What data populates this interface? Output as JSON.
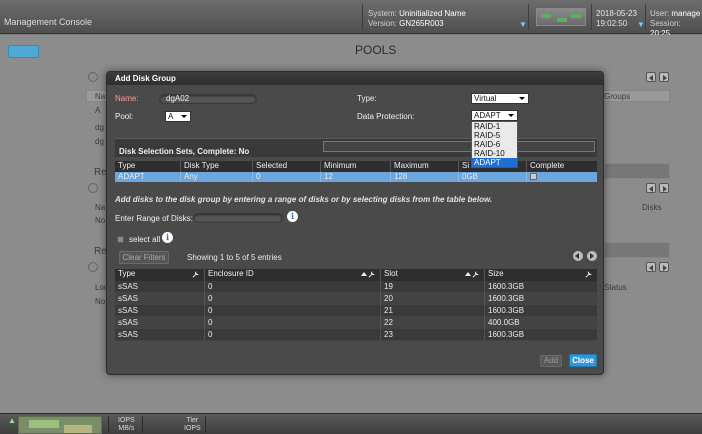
{
  "header": {
    "app_title": "Management Console",
    "system_label": "System:",
    "system_name": "Uninitialized Name",
    "version_label": "Version:",
    "version": "GN265R003",
    "date": "2018-05-23",
    "time": "19:02:50",
    "user_label": "User:",
    "user": "manage",
    "session_label": "Session:",
    "session": "20:25"
  },
  "page": {
    "title": "POOLS",
    "bg_labels": [
      "Na",
      "A",
      "dg",
      "dg",
      "Re",
      "Na",
      "No",
      "Re",
      "Loc",
      "No"
    ],
    "bg_right_labels": [
      "Groups",
      "Disks",
      "Status"
    ]
  },
  "bottom": {
    "iops_label": "IOPS",
    "mbs_label": "MB/s",
    "tier_label": "Tier",
    "tier_iops_label": "IOPS"
  },
  "modal": {
    "title": "Add Disk Group",
    "name_label": "Name:",
    "name_value": "dgA02",
    "pool_label": "Pool:",
    "pool_value": "A",
    "type_label": "Type:",
    "type_value": "Virtual",
    "protection_label": "Data Protection:",
    "protection_value": "ADAPT",
    "protection_options": [
      "RAID-1",
      "RAID-5",
      "RAID-6",
      "RAID-10",
      "ADAPT"
    ],
    "selected_option": "ADAPT",
    "selection_sets_title": "Disk Selection Sets, Complete: No",
    "sets_columns": [
      "Type",
      "Disk Type",
      "Selected",
      "Minimum",
      "Maximum",
      "Si",
      "Complete"
    ],
    "sets_rows": [
      {
        "type": "ADAPT",
        "disk_type": "Any",
        "selected": "0",
        "minimum": "12",
        "maximum": "128",
        "size": "0GB"
      }
    ],
    "instructions": "Add disks to the disk group by entering a range of disks or by selecting disks from the table below.",
    "range_label": "Enter Range of Disks:",
    "select_all_label": "select all",
    "clear_filters_label": "Clear Filters",
    "showing_text": "Showing 1 to 5 of 5 entries",
    "disk_columns": [
      "Type",
      "Enclosure ID",
      "Slot",
      "Size"
    ],
    "disk_rows": [
      {
        "type": "sSAS",
        "enclosure": "0",
        "slot": "19",
        "size": "1600.3GB"
      },
      {
        "type": "sSAS",
        "enclosure": "0",
        "slot": "20",
        "size": "1600.3GB"
      },
      {
        "type": "sSAS",
        "enclosure": "0",
        "slot": "21",
        "size": "1600.3GB"
      },
      {
        "type": "sSAS",
        "enclosure": "0",
        "slot": "22",
        "size": "400.0GB"
      },
      {
        "type": "sSAS",
        "enclosure": "0",
        "slot": "23",
        "size": "1600.3GB"
      }
    ],
    "add_label": "Add",
    "close_label": "Close"
  },
  "icons": {
    "info": "info-icon",
    "wrench": "wrench-icon",
    "search": "search-icon"
  },
  "colors": {
    "accent": "#2f97d5",
    "selected_row": "#6ca6dc",
    "dropdown_highlight": "#1e6fd1"
  }
}
